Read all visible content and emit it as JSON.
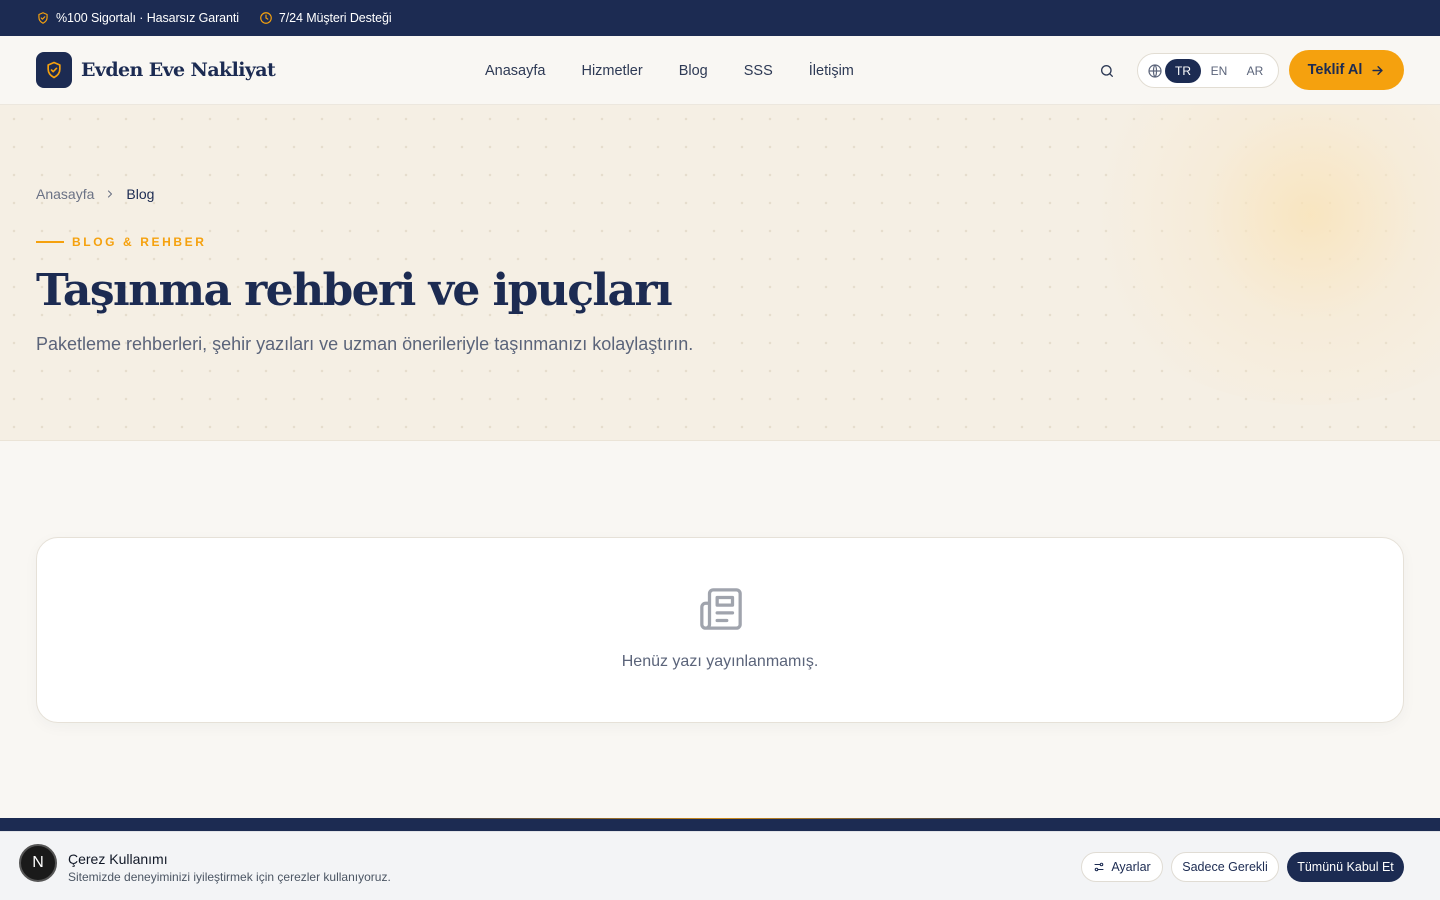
{
  "topbar": {
    "items": [
      {
        "icon": "shield-check-icon",
        "label": "%100 Sigortalı · Hasarsız Garanti"
      },
      {
        "icon": "clock-icon",
        "label": "7/24 Müşteri Desteği"
      }
    ]
  },
  "header": {
    "logo_text": "Evden Eve Nakliyat",
    "logo_icon": "shield-check-icon",
    "nav": [
      "Anasayfa",
      "Hizmetler",
      "Blog",
      "SSS",
      "İletişim"
    ],
    "languages": [
      "TR",
      "EN",
      "AR"
    ],
    "active_language": "TR",
    "cta_label": "Teklif Al"
  },
  "hero": {
    "breadcrumb": [
      "Anasayfa",
      "Blog"
    ],
    "eyebrow": "BLOG & REHBER",
    "title": "Taşınma rehberi ve ipuçları",
    "subtitle": "Paketleme rehberleri, şehir yazıları ve uzman önerileriyle taşınmanızı kolaylaştırın."
  },
  "empty_state": {
    "icon": "newspaper-icon",
    "message": "Henüz yazı yayınlanmamış."
  },
  "cookie": {
    "avatar_letter": "N",
    "title": "Çerez Kullanımı",
    "description": "Sitemizde deneyiminizi iyileştirmek için çerezler kullanıyoruz.",
    "settings_label": "Ayarlar",
    "necessary_label": "Sadece Gerekli",
    "accept_label": "Tümünü Kabul Et"
  },
  "colors": {
    "navy": "#1c2b52",
    "accent": "#f5a10e",
    "background": "#f9f7f3",
    "hero_background": "#f5efe4"
  }
}
